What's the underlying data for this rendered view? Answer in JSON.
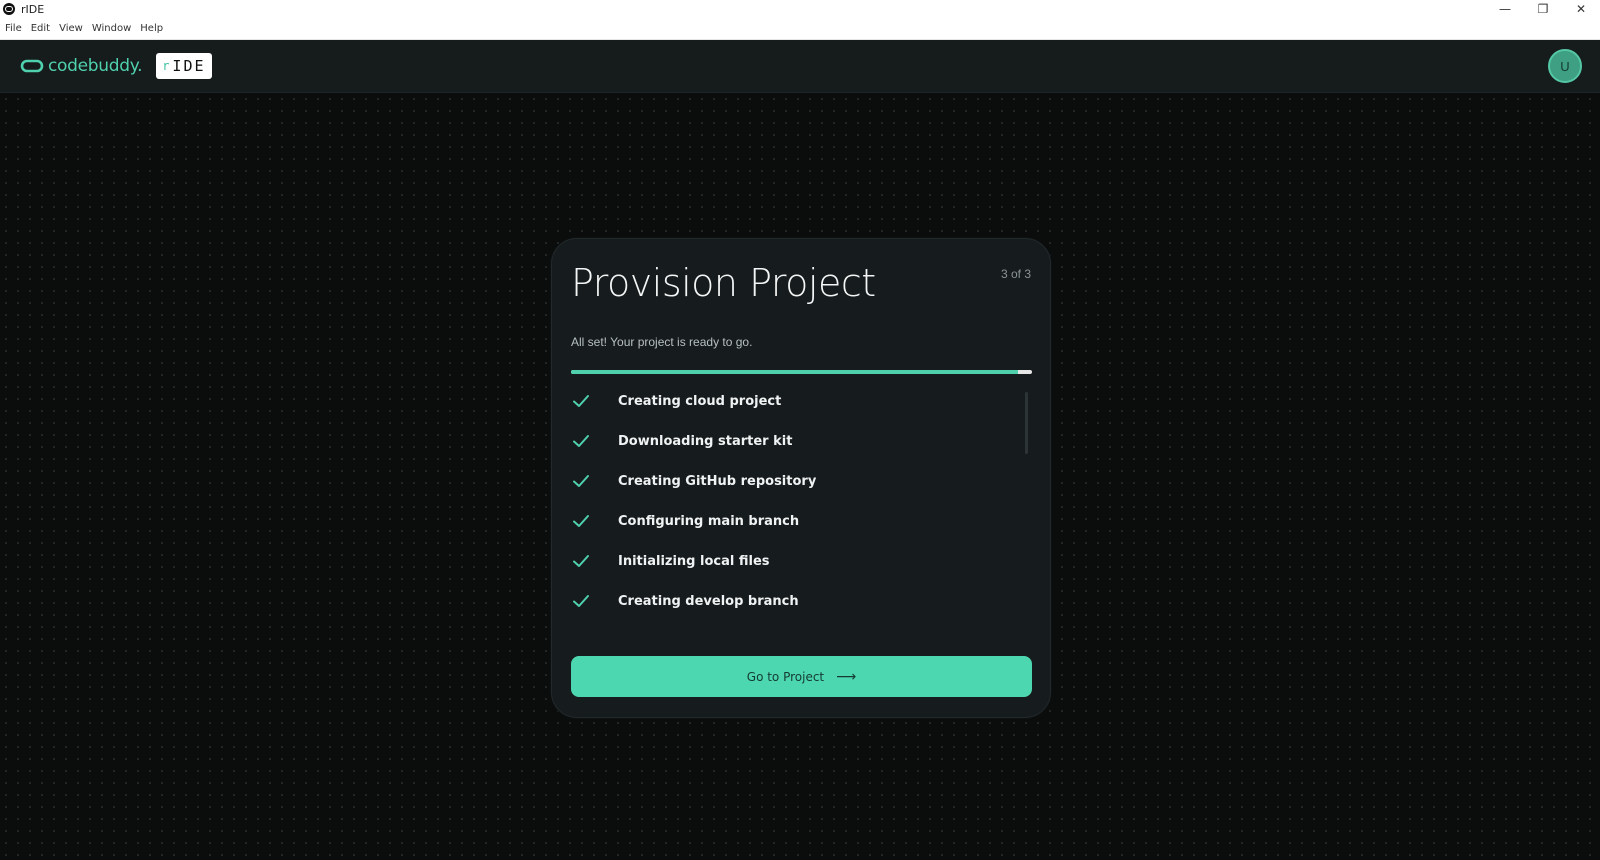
{
  "window": {
    "title": "rIDE",
    "controls": {
      "minimize": "—",
      "restore": "❐",
      "close": "✕"
    }
  },
  "menu": [
    "File",
    "Edit",
    "View",
    "Window",
    "Help"
  ],
  "header": {
    "brand": "codebuddy.",
    "ide_badge_r": "r",
    "ide_badge_text": "IDE",
    "avatar_initial": "U",
    "accent": "#4fd1ae"
  },
  "card": {
    "title": "Provision Project",
    "step_count": "3 of 3",
    "subtitle": "All set! Your project is ready to go.",
    "progress": 0.97,
    "steps": [
      {
        "label": "Creating cloud project",
        "status": "done"
      },
      {
        "label": "Downloading starter kit",
        "status": "done"
      },
      {
        "label": "Creating GitHub repository",
        "status": "done"
      },
      {
        "label": "Configuring main branch",
        "status": "done"
      },
      {
        "label": "Initializing local files",
        "status": "done"
      },
      {
        "label": "Creating develop branch",
        "status": "done"
      }
    ],
    "cta_label": "Go to Project",
    "cta_arrow": "⟶"
  }
}
